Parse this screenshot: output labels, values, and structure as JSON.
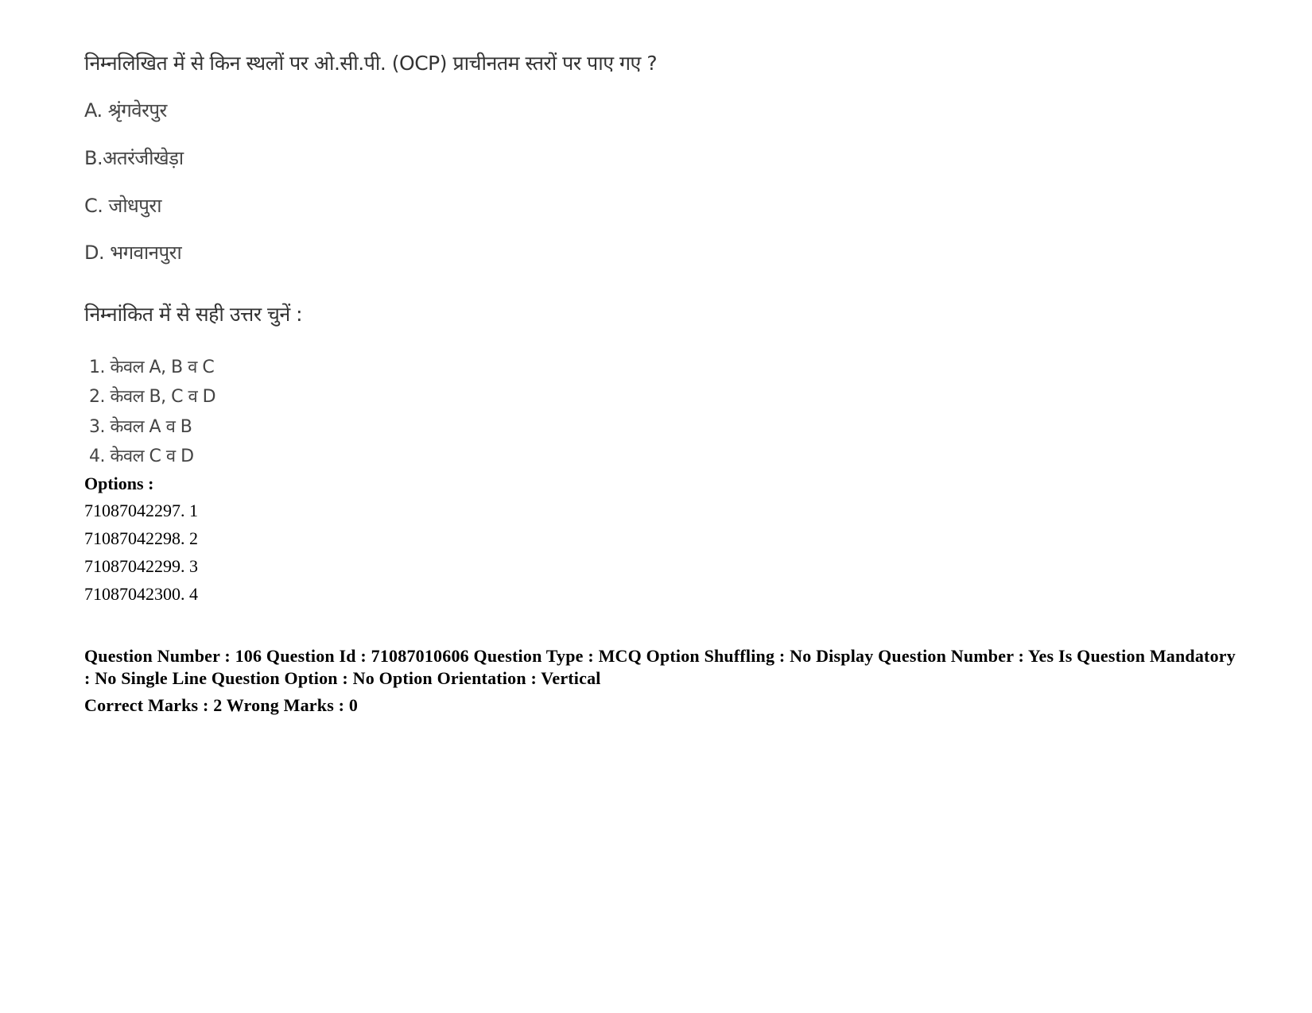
{
  "question": {
    "stem": "निम्नलिखित में से किन स्थलों पर ओ.सी.पी. (OCP) प्राचीनतम स्तरों पर पाए गए ?",
    "statements": [
      "A. श्रृंगवेरपुर",
      "B.अतरंजीखेड़ा",
      "C. जोधपुरा",
      "D. भगवानपुरा"
    ],
    "instruction": "निम्नांकित में से सही उत्तर चुनें :",
    "choices": [
      "1. केवल A, B व C",
      "2. केवल B, C व D",
      "3. केवल A व B",
      "4. केवल C व D"
    ]
  },
  "options": {
    "heading": "Options :",
    "items": [
      "71087042297. 1",
      "71087042298. 2",
      "71087042299. 3",
      "71087042300. 4"
    ]
  },
  "meta": {
    "line1": "Question Number : 106 Question Id : 71087010606 Question Type : MCQ Option Shuffling : No Display Question Number : Yes Is Question Mandatory : No Single Line Question Option : No Option Orientation : Vertical",
    "marks": "Correct Marks : 2 Wrong Marks : 0"
  }
}
